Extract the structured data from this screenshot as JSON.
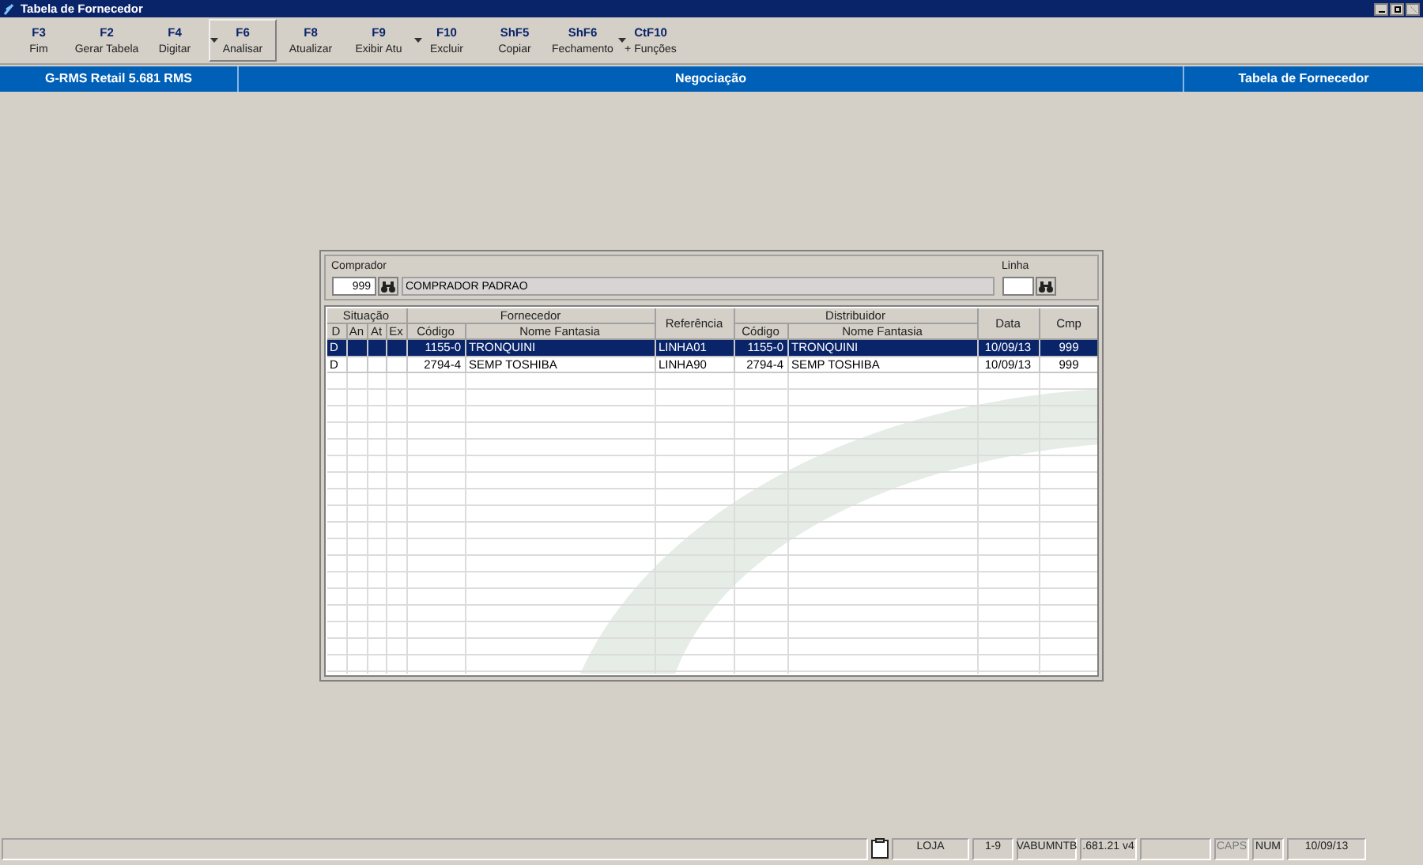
{
  "window": {
    "title": "Tabela de Fornecedor"
  },
  "toolbar": [
    {
      "key": "F3",
      "label": "Fim",
      "selected": false,
      "dropdown": false
    },
    {
      "key": "F2",
      "label": "Gerar Tabela",
      "selected": false,
      "dropdown": false
    },
    {
      "key": "F4",
      "label": "Digitar",
      "selected": false,
      "dropdown": true
    },
    {
      "key": "F6",
      "label": "Analisar",
      "selected": true,
      "dropdown": false
    },
    {
      "key": "F8",
      "label": "Atualizar",
      "selected": false,
      "dropdown": false
    },
    {
      "key": "F9",
      "label": "Exibir Atu",
      "selected": false,
      "dropdown": true
    },
    {
      "key": "F10",
      "label": "Excluir",
      "selected": false,
      "dropdown": false
    },
    {
      "key": "ShF5",
      "label": "Copiar",
      "selected": false,
      "dropdown": false
    },
    {
      "key": "ShF6",
      "label": "Fechamento",
      "selected": false,
      "dropdown": true
    },
    {
      "key": "CtF10",
      "label": "+ Funções",
      "selected": false,
      "dropdown": false
    }
  ],
  "banner": [
    "G-RMS Retail 5.681 RMS",
    "Negociação",
    "Tabela de Fornecedor"
  ],
  "filter": {
    "comprador_label": "Comprador",
    "comprador_code": "999",
    "comprador_name": "COMPRADOR PADRAO",
    "linha_label": "Linha"
  },
  "table": {
    "header_groups": [
      {
        "label": "Situação",
        "children": [
          "D",
          "An",
          "At",
          "Ex"
        ]
      },
      {
        "label": "Fornecedor",
        "children": [
          "Código",
          "Nome Fantasia"
        ]
      },
      {
        "label": "Referência"
      },
      {
        "label": "Distribuidor",
        "children": [
          "Código",
          "Nome Fantasia"
        ]
      },
      {
        "label": "Data"
      },
      {
        "label": "Cmp"
      }
    ],
    "rows": [
      {
        "selected": true,
        "cells": [
          "D",
          "",
          "",
          "",
          "1155-0",
          "TRONQUINI",
          "LINHA01",
          "1155-0",
          "TRONQUINI",
          "10/09/13",
          "999"
        ]
      },
      {
        "selected": false,
        "cells": [
          "D",
          "",
          "",
          "",
          "2794-4",
          "SEMP TOSHIBA",
          "LINHA90",
          "2794-4",
          "SEMP TOSHIBA",
          "10/09/13",
          "999"
        ]
      }
    ]
  },
  "status_bar": [
    {
      "kind": "icon"
    },
    {
      "kind": "text",
      "text": "LOJA",
      "disabled": false
    },
    {
      "kind": "text",
      "text": "1-9",
      "disabled": false
    },
    {
      "kind": "text",
      "text": "VABUMNTB",
      "disabled": false
    },
    {
      "kind": "text",
      "text": ".681.21 v4",
      "disabled": false
    },
    {
      "kind": "empty"
    },
    {
      "kind": "text",
      "text": "CAPS",
      "disabled": true
    },
    {
      "kind": "text",
      "text": "NUM",
      "disabled": false
    },
    {
      "kind": "text",
      "text": "10/09/13",
      "disabled": false
    }
  ]
}
